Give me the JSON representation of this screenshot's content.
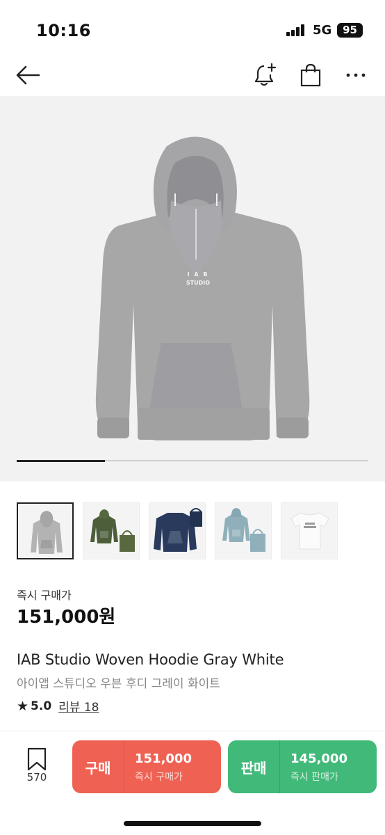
{
  "status_bar": {
    "time": "10:16",
    "network": "5G",
    "battery": "95"
  },
  "nav": {
    "icons": [
      "back-arrow-icon",
      "bell-plus-icon",
      "shopping-bag-icon",
      "more-dots-icon"
    ]
  },
  "product_image": {
    "logo_line1": "I A B",
    "logo_line2": "STUDIO",
    "carousel_progress": 0.25
  },
  "thumbnails": [
    {
      "name": "gray-hoodie",
      "color": "#b7b7b7",
      "selected": true
    },
    {
      "name": "green-jacket-bag",
      "color": "#4c5f3a",
      "selected": false
    },
    {
      "name": "navy-jacket-bag",
      "color": "#2a3a5c",
      "selected": false
    },
    {
      "name": "blue-jacket-bag",
      "color": "#8fb0bb",
      "selected": false
    },
    {
      "name": "white-tshirt",
      "color": "#f7f7f7",
      "selected": false
    }
  ],
  "price": {
    "label": "즉시 구매가",
    "value": "151,000원"
  },
  "product": {
    "name_en": "IAB Studio Woven Hoodie Gray White",
    "name_ko": "아이앱 스튜디오 우븐 후디 그레이 화이트",
    "rating": "5.0",
    "review_label": "리뷰 18"
  },
  "bottom_bar": {
    "bookmark_count": "570",
    "buy": {
      "label": "구매",
      "price": "151,000",
      "sub": "즉시 구매가",
      "color": "#ef6253"
    },
    "sell": {
      "label": "판매",
      "price": "145,000",
      "sub": "즉시 판매가",
      "color": "#41b979"
    }
  }
}
